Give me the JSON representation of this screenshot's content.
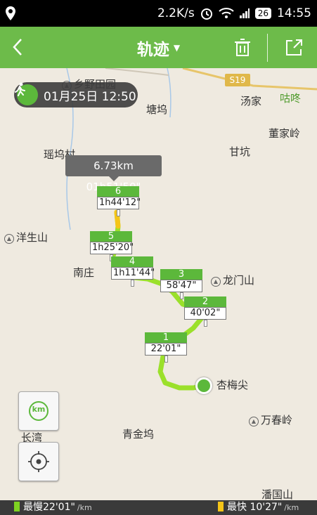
{
  "statusbar": {
    "speed": "2.2K/s",
    "battery": "26",
    "time": "14:55"
  },
  "appbar": {
    "title": "轨迹"
  },
  "map": {
    "date_label": "01月25日 12:50",
    "summary": "6.73km  01h51'50\"",
    "road_shield": "S19",
    "places": [
      {
        "name": "乡野田园"
      },
      {
        "name": "塘坞"
      },
      {
        "name": "汤家"
      },
      {
        "name": "咕咚"
      },
      {
        "name": "董家岭"
      },
      {
        "name": "瑶坞村"
      },
      {
        "name": "甘坑"
      },
      {
        "name": "洋生山"
      },
      {
        "name": "南庄"
      },
      {
        "name": "龙门山"
      },
      {
        "name": "杏梅尖"
      },
      {
        "name": "万春岭"
      },
      {
        "name": "长湾"
      },
      {
        "name": "青金坞"
      },
      {
        "name": "潘国山"
      }
    ],
    "markers": [
      {
        "num": "1",
        "time": "22'01\""
      },
      {
        "num": "2",
        "time": "40'02\""
      },
      {
        "num": "3",
        "time": "58'47\""
      },
      {
        "num": "4",
        "time": "1h11'44\""
      },
      {
        "num": "5",
        "time": "1h25'20\""
      },
      {
        "num": "6",
        "time": "1h44'12\""
      }
    ],
    "km_button": "km"
  },
  "bottombar": {
    "slow_label": "最慢",
    "slow_value": "22'01\"",
    "slow_unit": "/km",
    "fast_label": "最快",
    "fast_value": "10'27\"",
    "fast_unit": "/km"
  },
  "colors": {
    "accent": "#6dbb4a",
    "track": "#9be02b",
    "slow": "#7ed321",
    "fast": "#f5c518"
  }
}
